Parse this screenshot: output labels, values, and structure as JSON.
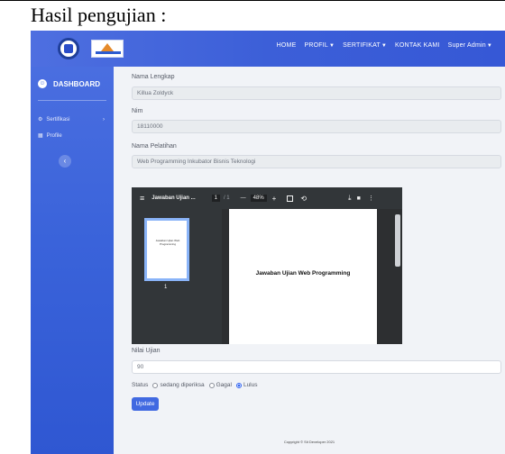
{
  "document": {
    "heading": "Hasil pengujian :"
  },
  "topbar": {
    "nav": [
      {
        "label": "HOME",
        "dropdown": false
      },
      {
        "label": "PROFIL",
        "dropdown": true
      },
      {
        "label": "SERTIFIKAT",
        "dropdown": true
      },
      {
        "label": "KONTAK KAMI",
        "dropdown": false
      },
      {
        "label": "Super Admin",
        "dropdown": true
      }
    ]
  },
  "sidebar": {
    "brand": "DASHBOARD",
    "items": [
      {
        "label": "Sertifikasi",
        "icon": "gear-icon",
        "chevron": "›"
      },
      {
        "label": "Profile",
        "icon": "table-icon",
        "chevron": ""
      }
    ],
    "toggle": "‹"
  },
  "form": {
    "nama_label": "Nama Lengkap",
    "nama_value": "Killua Zoldyck",
    "nim_label": "Nim",
    "nim_value": "18110000",
    "pelatihan_label": "Nama Pelatihan",
    "pelatihan_value": "Web Programming Inkubator Bisnis Teknologi",
    "nilai_label": "Nilai Ujian",
    "nilai_value": "90",
    "status_label": "Status",
    "status_options": [
      "sedang diperiksa",
      "Gagal",
      "Lulus"
    ],
    "status_selected": "Lulus",
    "update_label": "Update"
  },
  "pdf_viewer": {
    "menu_glyph": "≡",
    "title": "Jawaban Ujian ...",
    "page_current": "1",
    "page_total": "/ 1",
    "zoom_minus": "—",
    "zoom": "48%",
    "zoom_plus": "+",
    "thumb_text": "Jawaban Ujian Web Programming",
    "thumb_number": "1",
    "page_heading": "Jawaban Ujian Web Programming"
  },
  "footer": {
    "text": "Copyright © Sit Developer 2021"
  },
  "colors": {
    "primary": "#4169e1",
    "sidebar": "#3a63da",
    "pdf_toolbar": "#323639"
  }
}
